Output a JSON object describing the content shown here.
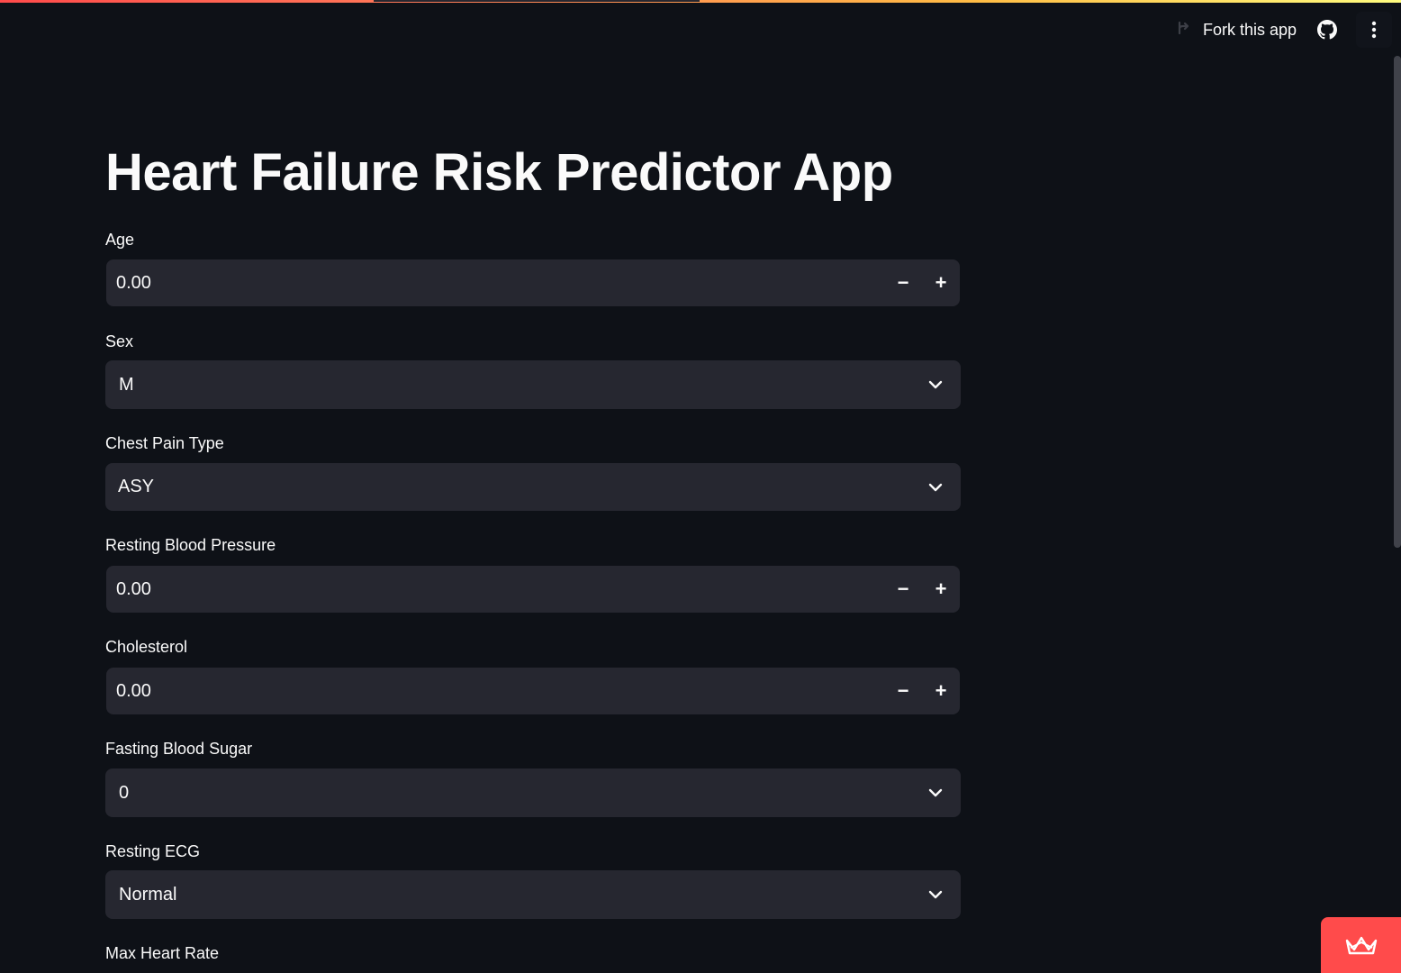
{
  "header": {
    "fork_label": "Fork this app",
    "icons": {
      "fork": "fork-icon",
      "github": "github-icon",
      "menu": "kebab-menu-icon"
    }
  },
  "main": {
    "title": "Heart Failure Risk Predictor App",
    "fields": {
      "age": {
        "label": "Age",
        "value": "0.00",
        "type": "number"
      },
      "sex": {
        "label": "Sex",
        "value": "M",
        "type": "select"
      },
      "chest_pain_type": {
        "label": "Chest Pain Type",
        "value": "ASY",
        "type": "select"
      },
      "resting_bp": {
        "label": "Resting Blood Pressure",
        "value": "0.00",
        "type": "number"
      },
      "cholesterol": {
        "label": "Cholesterol",
        "value": "0.00",
        "type": "number"
      },
      "fasting_bs": {
        "label": "Fasting Blood Sugar",
        "value": "0",
        "type": "select"
      },
      "resting_ecg": {
        "label": "Resting ECG",
        "value": "Normal",
        "type": "select"
      },
      "max_hr": {
        "label": "Max Heart Rate"
      }
    },
    "stepper": {
      "minus": "−",
      "plus": "+"
    }
  },
  "badge": {
    "icon": "crown-icon"
  },
  "colors": {
    "background": "#0e1117",
    "input_bg": "#262730",
    "text": "#fafafa",
    "accent": "#ff4b4b"
  }
}
